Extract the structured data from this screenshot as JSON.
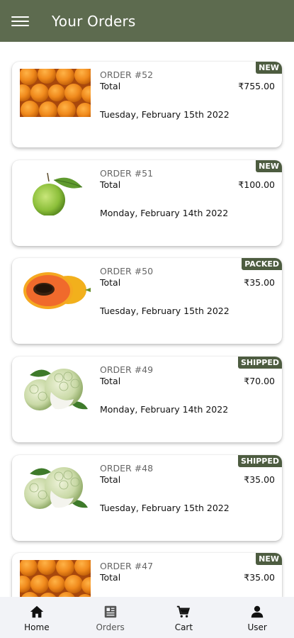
{
  "header": {
    "title": "Your Orders",
    "menu_icon": "hamburger-menu-icon"
  },
  "orders": [
    {
      "order_no": "ORDER #52",
      "total_label": "Total",
      "amount": "₹755.00",
      "date": "Tuesday, February 15th 2022",
      "status": "NEW",
      "product_image": "oranges"
    },
    {
      "order_no": "ORDER #51",
      "total_label": "Total",
      "amount": "₹100.00",
      "date": "Monday, February 14th 2022",
      "status": "NEW",
      "product_image": "guava"
    },
    {
      "order_no": "ORDER #50",
      "total_label": "Total",
      "amount": "₹35.00",
      "date": "Tuesday, February 15th 2022",
      "status": "PACKED",
      "product_image": "papaya"
    },
    {
      "order_no": "ORDER #49",
      "total_label": "Total",
      "amount": "₹70.00",
      "date": "Monday, February 14th 2022",
      "status": "SHIPPED",
      "product_image": "custard-apple"
    },
    {
      "order_no": "ORDER #48",
      "total_label": "Total",
      "amount": "₹35.00",
      "date": "Tuesday, February 15th 2022",
      "status": "SHIPPED",
      "product_image": "custard-apple"
    },
    {
      "order_no": "ORDER #47",
      "total_label": "Total",
      "amount": "₹35.00",
      "date": "",
      "status": "NEW",
      "product_image": "oranges"
    }
  ],
  "bottom_nav": {
    "items": [
      {
        "label": "Home",
        "icon": "home-icon"
      },
      {
        "label": "Orders",
        "icon": "orders-icon",
        "active": true
      },
      {
        "label": "Cart",
        "icon": "cart-icon"
      },
      {
        "label": "User",
        "icon": "user-icon"
      }
    ]
  },
  "colors": {
    "appbar": "#5d6b4f",
    "badge": "#4d5c40",
    "nav_background": "#f2f3f7"
  }
}
